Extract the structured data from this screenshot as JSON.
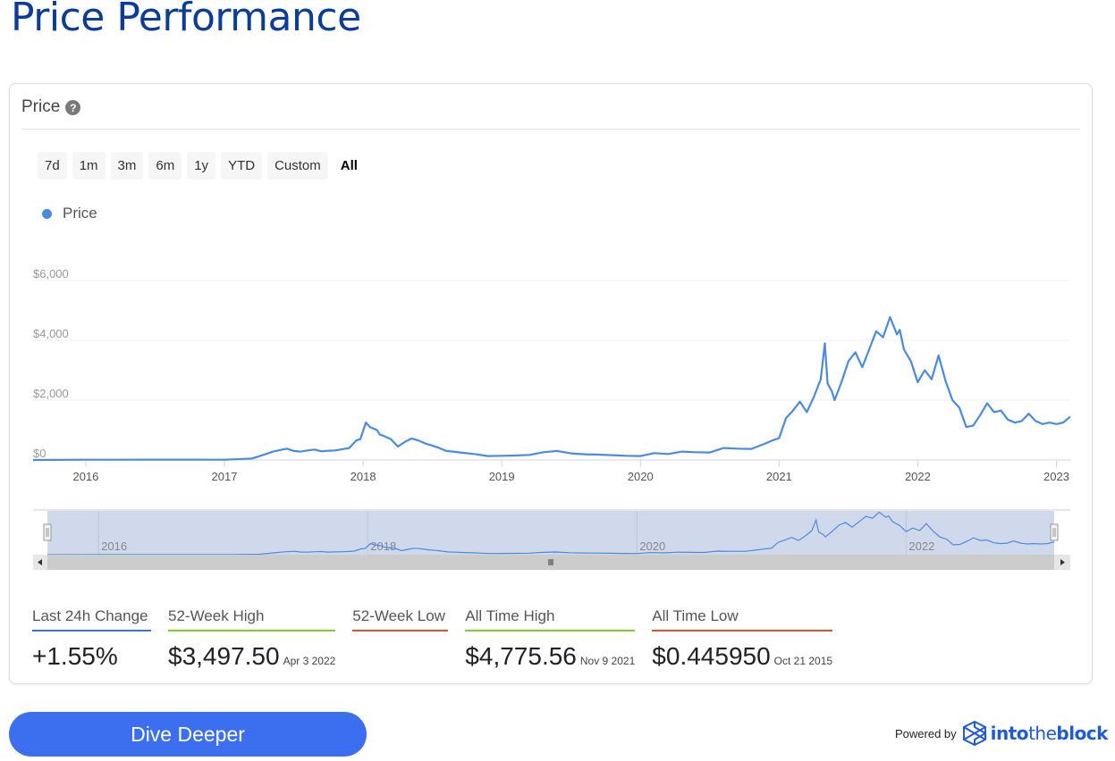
{
  "page": {
    "title": "Price Performance"
  },
  "card": {
    "title": "Price",
    "help_icon": "question-circle-icon"
  },
  "range_buttons": [
    {
      "label": "7d",
      "active": false
    },
    {
      "label": "1m",
      "active": false
    },
    {
      "label": "3m",
      "active": false
    },
    {
      "label": "6m",
      "active": false
    },
    {
      "label": "1y",
      "active": false
    },
    {
      "label": "YTD",
      "active": false
    },
    {
      "label": "Custom",
      "active": false
    },
    {
      "label": "All",
      "active": true
    }
  ],
  "colors": {
    "title": "#0a3c9b",
    "line": "#4a8be0",
    "navigator_fill": "#d0d9ec",
    "button": "#3c6ff0",
    "blue_underline": "#3474e6",
    "green_underline": "#7ed321",
    "red_underline": "#d9532c"
  },
  "chart_data": {
    "type": "line",
    "title": "Price",
    "legend": [
      "Price"
    ],
    "legend_position": "top-left",
    "ylabel": "",
    "xlabel": "",
    "ylim": [
      0,
      6000
    ],
    "yticks": [
      "$0",
      "$2,000",
      "$4,000",
      "$6,000"
    ],
    "ytick_values": [
      0,
      2000,
      4000,
      6000
    ],
    "xticks": [
      "2016",
      "2017",
      "2018",
      "2019",
      "2020",
      "2021",
      "2022",
      "2023"
    ],
    "xtick_values": [
      2016.0,
      2017.0,
      2018.0,
      2019.0,
      2020.0,
      2021.0,
      2022.0,
      2023.0
    ],
    "xlim": [
      2015.62,
      2023.1
    ],
    "grid": true,
    "series": [
      {
        "name": "Price",
        "x": [
          2015.62,
          2016.0,
          2016.2,
          2016.5,
          2016.8,
          2017.0,
          2017.2,
          2017.3,
          2017.35,
          2017.45,
          2017.5,
          2017.55,
          2017.6,
          2017.65,
          2017.7,
          2017.75,
          2017.8,
          2017.9,
          2017.95,
          2017.98,
          2018.02,
          2018.05,
          2018.1,
          2018.12,
          2018.15,
          2018.2,
          2018.25,
          2018.3,
          2018.35,
          2018.4,
          2018.45,
          2018.5,
          2018.55,
          2018.6,
          2018.65,
          2018.7,
          2018.8,
          2018.9,
          2019.0,
          2019.1,
          2019.2,
          2019.3,
          2019.4,
          2019.5,
          2019.6,
          2019.7,
          2019.8,
          2019.9,
          2020.0,
          2020.1,
          2020.2,
          2020.3,
          2020.4,
          2020.5,
          2020.6,
          2020.7,
          2020.8,
          2020.9,
          2020.95,
          2021.0,
          2021.05,
          2021.1,
          2021.15,
          2021.2,
          2021.25,
          2021.3,
          2021.33,
          2021.35,
          2021.38,
          2021.4,
          2021.45,
          2021.5,
          2021.55,
          2021.6,
          2021.65,
          2021.7,
          2021.75,
          2021.8,
          2021.85,
          2021.87,
          2021.9,
          2021.95,
          2022.0,
          2022.05,
          2022.1,
          2022.15,
          2022.2,
          2022.25,
          2022.3,
          2022.35,
          2022.4,
          2022.45,
          2022.5,
          2022.55,
          2022.6,
          2022.65,
          2022.7,
          2022.75,
          2022.8,
          2022.85,
          2022.9,
          2022.95,
          2023.0,
          2023.05,
          2023.1
        ],
        "y": [
          1,
          8,
          10,
          12,
          11,
          8,
          50,
          200,
          280,
          380,
          300,
          280,
          320,
          350,
          290,
          310,
          320,
          400,
          650,
          700,
          1250,
          1100,
          1000,
          850,
          800,
          700,
          450,
          600,
          720,
          650,
          550,
          480,
          400,
          300,
          280,
          250,
          200,
          130,
          140,
          150,
          170,
          260,
          300,
          220,
          190,
          180,
          160,
          140,
          130,
          230,
          200,
          280,
          260,
          250,
          400,
          380,
          370,
          550,
          650,
          730,
          1400,
          1650,
          1950,
          1600,
          2100,
          2700,
          3900,
          2550,
          2300,
          2000,
          2600,
          3300,
          3600,
          3100,
          3700,
          4300,
          4100,
          4775,
          4200,
          4350,
          3700,
          3300,
          2600,
          3000,
          2700,
          3497,
          2650,
          2000,
          1750,
          1100,
          1150,
          1500,
          1900,
          1600,
          1650,
          1350,
          1250,
          1300,
          1550,
          1300,
          1200,
          1250,
          1200,
          1250,
          1450
        ]
      }
    ],
    "navigator": {
      "xticks": [
        "2016",
        "2018",
        "2020",
        "2022"
      ]
    }
  },
  "stats": [
    {
      "label": "Last 24h Change",
      "value": "+1.55%",
      "date": "",
      "underline": "blue"
    },
    {
      "label": "52-Week High",
      "value": "$3,497.50",
      "date": "Apr 3 2022",
      "underline": "green"
    },
    {
      "label": "52-Week Low",
      "value": "",
      "date": "",
      "underline": "red"
    },
    {
      "label": "All Time High",
      "value": "$4,775.56",
      "date": "Nov 9 2021",
      "underline": "green"
    },
    {
      "label": "All Time Low",
      "value": "$0.445950",
      "date": "Oct 21 2015",
      "underline": "red"
    }
  ],
  "footer": {
    "dive_button": "Dive Deeper",
    "powered_by": "Powered by",
    "brand_into": "into",
    "brand_the": "the",
    "brand_block": "block"
  }
}
